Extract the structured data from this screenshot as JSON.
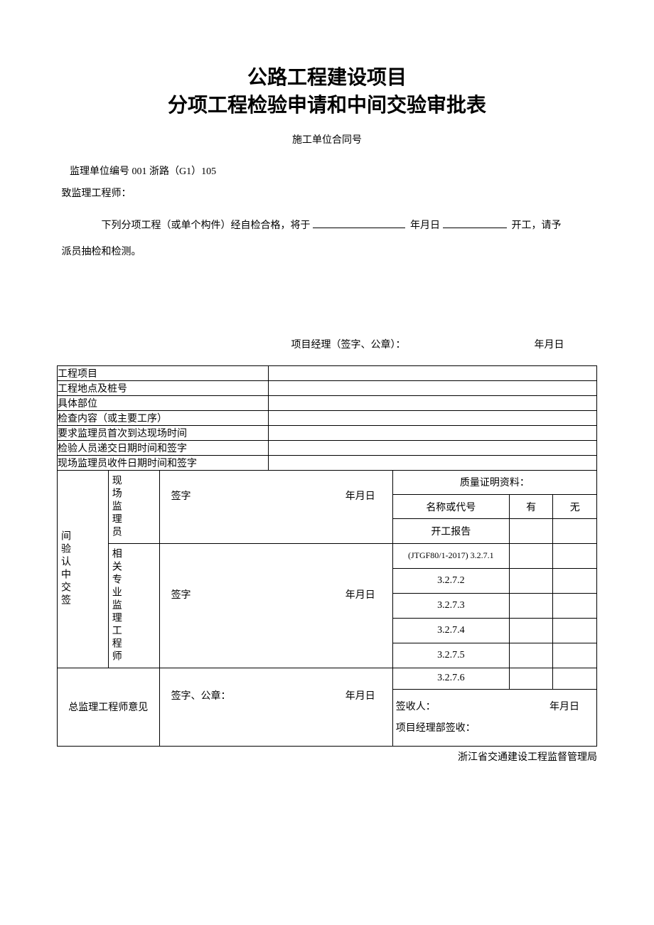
{
  "title_line1": "公路工程建设项目",
  "title_line2": "分项工程检验申请和中间交验审批表",
  "subheader": "施工单位合同号",
  "ref_line": "监理单位编号 001 浙路（G1）105",
  "intro": {
    "salutation": "致监理工程师：",
    "body_before": "下列分项工程（或单个构件）经自检合格，将于",
    "body_mid": "年月日",
    "body_after": "开工，请予",
    "body_tail": "派员抽检和检测。",
    "sig_label": "项目经理（签字、公章）：",
    "sig_date": "年月日"
  },
  "rows": {
    "project": "工程项目",
    "location": "工程地点及桩号",
    "part": "具体部位",
    "content": "检查内容（或主要工序）",
    "first_arrival": "要求监理员首次到达现场时间",
    "inspector_submit": "检验人员递交日期时间和签字",
    "site_receive": "现场监理员收件日期时间和签字"
  },
  "mid": {
    "group": "间验认中交签",
    "role1": "现场监理员",
    "role2": "相关专业监理工程师",
    "sign": "签字",
    "date": "年月日"
  },
  "cert": {
    "title": "质量证明资料：",
    "name": "名称或代号",
    "yes": "有",
    "no": "无",
    "items": [
      "开工报告",
      "(JTGF80/1-2017) 3.2.7.1",
      "3.2.7.2",
      "3.2.7.3",
      "3.2.7.4",
      "3.2.7.5",
      "3.2.7.6"
    ]
  },
  "bottom": {
    "opinion": "总监理工程师意见",
    "sign_seal": "签字、公章：",
    "date": "年月日",
    "recv_title": "项目经理部签收：",
    "recv_person": "签收人：",
    "recv_date": "年月日"
  },
  "footer": "浙江省交通建设工程监督管理局"
}
